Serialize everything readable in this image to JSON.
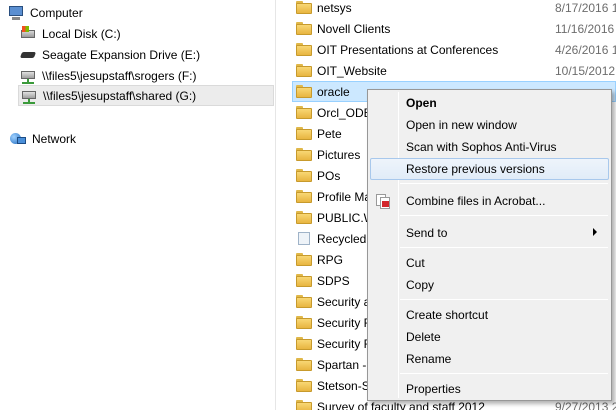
{
  "nav": {
    "items": [
      {
        "label": "Computer",
        "icon": "computer-icon"
      },
      {
        "label": "Local Disk (C:)",
        "icon": "local-disk-icon"
      },
      {
        "label": "Seagate Expansion Drive (E:)",
        "icon": "external-drive-icon"
      },
      {
        "label": "\\\\files5\\jesupstaff\\srogers (F:)",
        "icon": "network-drive-icon"
      },
      {
        "label": "\\\\files5\\jesupstaff\\shared (G:)",
        "icon": "network-drive-icon"
      },
      {
        "label": "Network",
        "icon": "network-icon"
      }
    ]
  },
  "files": {
    "rows": [
      {
        "name": "netsys",
        "date": "8/17/2016 1"
      },
      {
        "name": "Novell Clients",
        "date": "11/16/2016"
      },
      {
        "name": "OIT Presentations at Conferences",
        "date": "4/26/2016 1"
      },
      {
        "name": "OIT_Website",
        "date": "10/15/2012"
      },
      {
        "name": "oracle",
        "date": ""
      },
      {
        "name": "Orcl_ODB",
        "date": ""
      },
      {
        "name": "Pete",
        "date": ""
      },
      {
        "name": "Pictures",
        "date": ""
      },
      {
        "name": "POs",
        "date": ""
      },
      {
        "name": "Profile Ma",
        "date": ""
      },
      {
        "name": "PUBLIC.W",
        "date": ""
      },
      {
        "name": "Recycled",
        "date": ""
      },
      {
        "name": "RPG",
        "date": ""
      },
      {
        "name": "SDPS",
        "date": ""
      },
      {
        "name": "Security a",
        "date": ""
      },
      {
        "name": "Security R",
        "date": ""
      },
      {
        "name": "Security R",
        "date": ""
      },
      {
        "name": "Spartan -",
        "date": ""
      },
      {
        "name": "Stetson-S",
        "date": ""
      },
      {
        "name": "Survey of faculty and staff 2012",
        "date": "9/27/2013 2"
      }
    ]
  },
  "context_menu": {
    "items": [
      {
        "label": "Open"
      },
      {
        "label": "Open in new window"
      },
      {
        "label": "Scan with Sophos Anti-Virus"
      },
      {
        "label": "Restore previous versions"
      },
      {
        "label": "Combine files in Acrobat..."
      },
      {
        "label": "Send to"
      },
      {
        "label": "Cut"
      },
      {
        "label": "Copy"
      },
      {
        "label": "Create shortcut"
      },
      {
        "label": "Delete"
      },
      {
        "label": "Rename"
      },
      {
        "label": "Properties"
      }
    ]
  }
}
